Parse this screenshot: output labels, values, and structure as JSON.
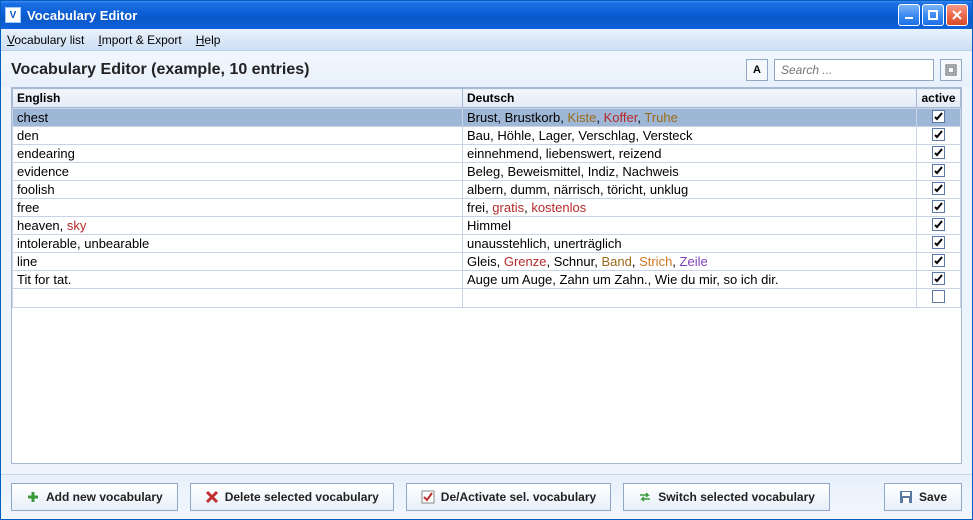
{
  "window": {
    "title": "Vocabulary Editor"
  },
  "menubar": {
    "items": [
      {
        "label": "Vocabulary list",
        "ul": "V"
      },
      {
        "label": "Import & Export",
        "ul": "I"
      },
      {
        "label": "Help",
        "ul": "H"
      }
    ]
  },
  "header": {
    "heading": "Vocabulary Editor (example, 10 entries)",
    "sort_button_label": "A",
    "search_placeholder": "Search ..."
  },
  "table": {
    "columns": {
      "english": "English",
      "deutsch": "Deutsch",
      "active": "active"
    },
    "rows": [
      {
        "selected": true,
        "active": true,
        "english": [
          {
            "t": "chest",
            "c": "default"
          }
        ],
        "deutsch": [
          {
            "t": "Brust",
            "c": "default"
          },
          {
            "t": "Brustkorb",
            "c": "default"
          },
          {
            "t": "Kiste",
            "c": "brown"
          },
          {
            "t": "Koffer",
            "c": "red"
          },
          {
            "t": "Truhe",
            "c": "brown"
          }
        ]
      },
      {
        "selected": false,
        "active": true,
        "english": [
          {
            "t": "den",
            "c": "default"
          }
        ],
        "deutsch": [
          {
            "t": "Bau",
            "c": "default"
          },
          {
            "t": "Höhle",
            "c": "default"
          },
          {
            "t": "Lager",
            "c": "default"
          },
          {
            "t": "Verschlag",
            "c": "default"
          },
          {
            "t": "Versteck",
            "c": "default"
          }
        ]
      },
      {
        "selected": false,
        "active": true,
        "english": [
          {
            "t": "endearing",
            "c": "default"
          }
        ],
        "deutsch": [
          {
            "t": "einnehmend",
            "c": "default"
          },
          {
            "t": "liebenswert",
            "c": "default"
          },
          {
            "t": "reizend",
            "c": "default"
          }
        ]
      },
      {
        "selected": false,
        "active": true,
        "english": [
          {
            "t": "evidence",
            "c": "default"
          }
        ],
        "deutsch": [
          {
            "t": "Beleg",
            "c": "default"
          },
          {
            "t": "Beweismittel",
            "c": "default"
          },
          {
            "t": "Indiz",
            "c": "default"
          },
          {
            "t": "Nachweis",
            "c": "default"
          }
        ]
      },
      {
        "selected": false,
        "active": true,
        "english": [
          {
            "t": "foolish",
            "c": "default"
          }
        ],
        "deutsch": [
          {
            "t": "albern",
            "c": "default"
          },
          {
            "t": "dumm",
            "c": "default"
          },
          {
            "t": "närrisch",
            "c": "default"
          },
          {
            "t": "töricht",
            "c": "default"
          },
          {
            "t": "unklug",
            "c": "default"
          }
        ]
      },
      {
        "selected": false,
        "active": true,
        "english": [
          {
            "t": "free",
            "c": "default"
          }
        ],
        "deutsch": [
          {
            "t": "frei",
            "c": "default"
          },
          {
            "t": "gratis",
            "c": "red"
          },
          {
            "t": "kostenlos",
            "c": "red"
          }
        ]
      },
      {
        "selected": false,
        "active": true,
        "english": [
          {
            "t": "heaven",
            "c": "default"
          },
          {
            "t": "sky",
            "c": "red"
          }
        ],
        "deutsch": [
          {
            "t": "Himmel",
            "c": "default"
          }
        ]
      },
      {
        "selected": false,
        "active": true,
        "english": [
          {
            "t": "intolerable",
            "c": "default"
          },
          {
            "t": "unbearable",
            "c": "default"
          }
        ],
        "deutsch": [
          {
            "t": "unausstehlich",
            "c": "default"
          },
          {
            "t": "unerträglich",
            "c": "default"
          }
        ]
      },
      {
        "selected": false,
        "active": true,
        "english": [
          {
            "t": "line",
            "c": "default"
          }
        ],
        "deutsch": [
          {
            "t": "Gleis",
            "c": "default"
          },
          {
            "t": "Grenze",
            "c": "red"
          },
          {
            "t": "Schnur",
            "c": "default"
          },
          {
            "t": "Band",
            "c": "brown"
          },
          {
            "t": "Strich",
            "c": "orange"
          },
          {
            "t": "Zeile",
            "c": "purple"
          }
        ]
      },
      {
        "selected": false,
        "active": true,
        "english": [
          {
            "t": "Tit for tat.",
            "c": "default"
          }
        ],
        "deutsch": [
          {
            "t": "Auge um Auge, Zahn um Zahn.",
            "c": "default"
          },
          {
            "t": "Wie du mir, so ich dir.",
            "c": "default"
          }
        ]
      }
    ],
    "empty_row": true
  },
  "buttons": {
    "add": "Add new vocabulary",
    "delete": "Delete selected vocabulary",
    "deactivate": "De/Activate sel. vocabulary",
    "switch": "Switch selected vocabulary",
    "save": "Save"
  },
  "colors": {
    "default": "#000000",
    "red": "#b52a2a",
    "brown": "#9a6a18",
    "purple": "#7a3fb5",
    "orange": "#d07820"
  }
}
